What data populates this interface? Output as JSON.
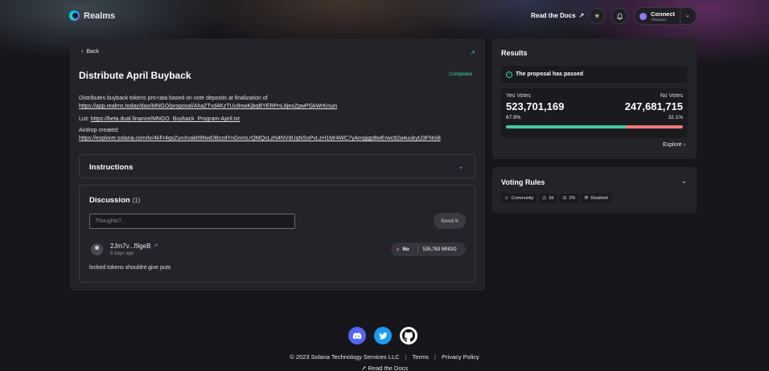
{
  "header": {
    "logo_text": "Realms",
    "read_docs": "Read the Docs",
    "connect_title": "Connect",
    "connect_sub": "Phantom"
  },
  "proposal": {
    "back_label": "Back",
    "title": "Distribute April Buyback",
    "status": "Completed",
    "desc_line1_text": "Distributes buyback tokens pro-rata based on vote deposits at finalization of ",
    "desc_line1_link": "https://app.realms.today/dao/MNGO/proposal/AhaZTvd4KzTUu9nwKjbqBYERPnL8jexZpwPGkWrKnuin",
    "desc_line2_text": "List: ",
    "desc_line2_link": "https://beta.dual.finance/MNGO_Buyback_Program-April.txt",
    "desc_line3_text": "Airdrop created: ",
    "desc_line3_link": "https://explorer.solana.com/tx/4kFr4qxZunXvaktI9NwDBzzdYnGnmLrQMQcLzN4NVdUqNSsPvLzH1Mr4WC7yAmgjgpBwErwc82a4uukytJ3FNni8"
  },
  "instructions": {
    "label": "Instructions"
  },
  "discussion": {
    "title": "Discussion",
    "count": "(1)",
    "placeholder": "Thoughts?...",
    "send_label": "Send It",
    "comment": {
      "author": "2Jm7v...f9geB",
      "time": "8 days ago",
      "vote": "No",
      "amount": "535,763 MNGO",
      "text": "locked tokens shouldnt give puts"
    }
  },
  "results": {
    "title": "Results",
    "passed": "The proposal has passed",
    "yes_label": "Yes Votes",
    "yes_count": "523,701,169",
    "yes_pct": "67.9%",
    "no_label": "No Votes",
    "no_count": "247,681,715",
    "no_pct": "32.1%",
    "yes_fraction": 0.679,
    "explore": "Explore"
  },
  "voting_rules": {
    "title": "Voting Rules",
    "tags": [
      "Community",
      "3d",
      "2%",
      "Disabled"
    ]
  },
  "footer": {
    "copyright": "© 2023 Solana Technology Services LLC",
    "terms": "Terms",
    "privacy": "Privacy Policy",
    "docs": "Read the Docs"
  },
  "colors": {
    "accent": "#5ab6e8",
    "yes": "#45c9a0",
    "no": "#ef7a7a",
    "completed": "#3fd0a6"
  }
}
